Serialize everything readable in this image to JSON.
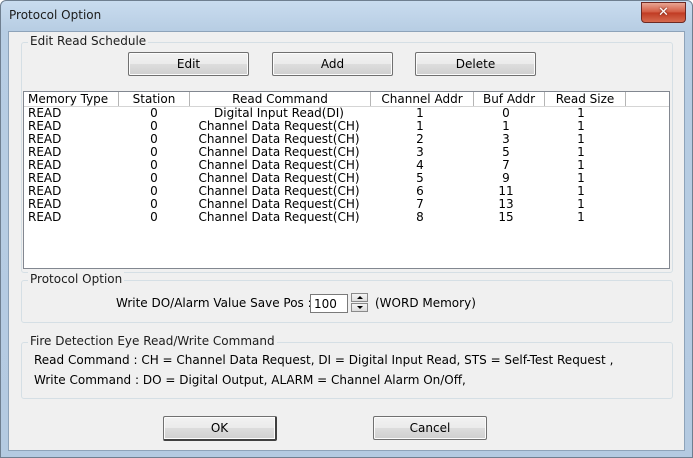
{
  "window": {
    "title": "Protocol Option",
    "close_glyph": "✕",
    "close_icon": "close-icon"
  },
  "edit_schedule": {
    "group_label": "Edit Read Schedule",
    "edit_label": "Edit",
    "add_label": "Add",
    "delete_label": "Delete",
    "columns": [
      "Memory Type",
      "Station",
      "Read Command",
      "Channel Addr",
      "Buf Addr",
      "Read Size"
    ],
    "rows": [
      [
        "READ",
        "0",
        "Digital Input Read(DI)",
        "1",
        "0",
        "1"
      ],
      [
        "READ",
        "0",
        "Channel Data Request(CH)",
        "1",
        "1",
        "1"
      ],
      [
        "READ",
        "0",
        "Channel Data Request(CH)",
        "2",
        "3",
        "1"
      ],
      [
        "READ",
        "0",
        "Channel Data Request(CH)",
        "3",
        "5",
        "1"
      ],
      [
        "READ",
        "0",
        "Channel Data Request(CH)",
        "4",
        "7",
        "1"
      ],
      [
        "READ",
        "0",
        "Channel Data Request(CH)",
        "5",
        "9",
        "1"
      ],
      [
        "READ",
        "0",
        "Channel Data Request(CH)",
        "6",
        "11",
        "1"
      ],
      [
        "READ",
        "0",
        "Channel Data Request(CH)",
        "7",
        "13",
        "1"
      ],
      [
        "READ",
        "0",
        "Channel Data Request(CH)",
        "8",
        "15",
        "1"
      ]
    ]
  },
  "protocol_option": {
    "group_label": "Protocol Option",
    "field_label": "Write DO/Alarm Value Save Pos :",
    "value": "100",
    "unit_label": "(WORD Memory)"
  },
  "fire_detection": {
    "group_label": "Fire Detection Eye Read/Write Command",
    "read_line": "Read Command : CH = Channel Data Request, DI = Digital Input Read, STS = Self-Test Request ,",
    "write_line": "Write Command : DO = Digital Output, ALARM = Channel Alarm On/Off,"
  },
  "footer": {
    "ok_label": "OK",
    "cancel_label": "Cancel"
  }
}
